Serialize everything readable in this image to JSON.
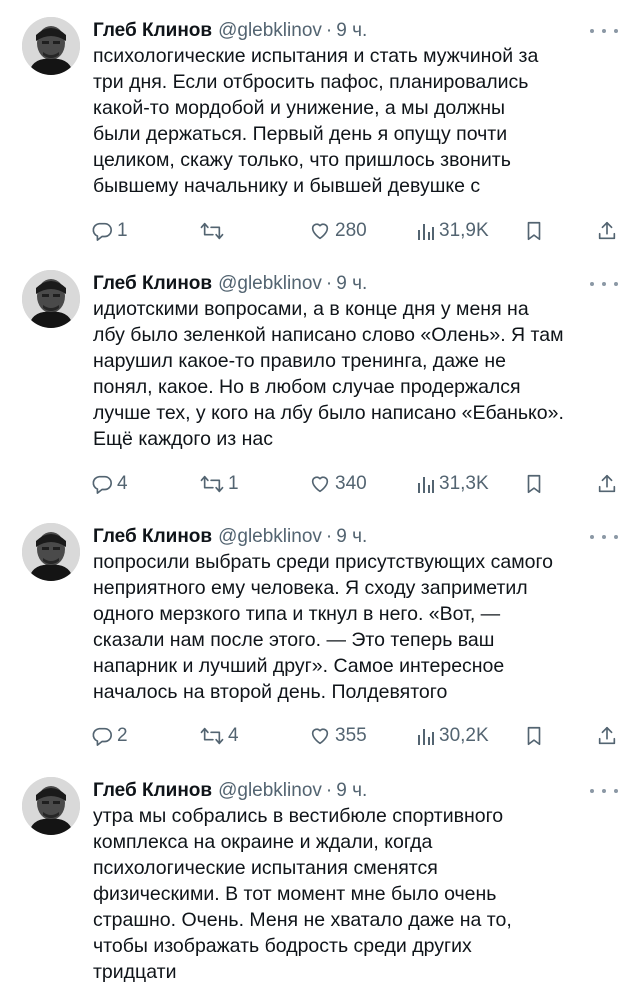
{
  "tweets": [
    {
      "author_name": "Глеб Клинов",
      "handle": "@glebklinov",
      "separator": "·",
      "time": "9 ч.",
      "lines": [
        "психологические испытания и стать мужчиной за",
        "три дня. Если отбросить пафос, планировались",
        "какой-то мордобой и унижение, а мы должны",
        "были держаться. Первый день я опущу почти",
        "целиком, скажу только, что пришлось звонить",
        "бывшему начальнику и бывшей девушке с"
      ],
      "replies": "1",
      "retweets": "",
      "likes": "280",
      "views": "31,9K"
    },
    {
      "author_name": "Глеб Клинов",
      "handle": "@glebklinov",
      "separator": "·",
      "time": "9 ч.",
      "lines": [
        "идиотскими вопросами, а в конце дня у меня на",
        "лбу было зеленкой написано слово «Олень». Я там",
        "нарушил какое-то правило тренинга, даже не",
        "понял, какое. Но в любом случае продержался",
        "лучше тех, у кого на лбу было написано «Ебанько».",
        "Ещё каждого из нас"
      ],
      "replies": "4",
      "retweets": "1",
      "likes": "340",
      "views": "31,3K"
    },
    {
      "author_name": "Глеб Клинов",
      "handle": "@glebklinov",
      "separator": "·",
      "time": "9 ч.",
      "lines": [
        "попросили выбрать среди присутствующих самого",
        "неприятного ему человека. Я сходу заприметил",
        "одного мерзкого типа и ткнул в него. «Вот, —",
        "сказали нам после этого. — Это теперь ваш",
        "напарник и лучший друг». Самое интересное",
        "началось на второй день. Полдевятого"
      ],
      "replies": "2",
      "retweets": "4",
      "likes": "355",
      "views": "30,2K"
    },
    {
      "author_name": "Глеб Клинов",
      "handle": "@glebklinov",
      "separator": "·",
      "time": "9 ч.",
      "lines": [
        "утра мы собрались в вестибюле спортивного",
        "комплекса на окраине и ждали, когда",
        "психологические испытания сменятся",
        "физическими. В тот момент мне было очень",
        "страшно. Очень. Меня не хватало даже на то,",
        "чтобы изображать бодрость среди других",
        "тридцати"
      ]
    }
  ],
  "icons": {
    "reply": "reply-icon",
    "retweet": "retweet-icon",
    "like": "heart-icon",
    "views": "views-icon",
    "bookmark": "bookmark-icon",
    "share": "share-icon",
    "more": "more-icon"
  },
  "colors": {
    "text": "#0f1419",
    "secondary": "#536471"
  }
}
